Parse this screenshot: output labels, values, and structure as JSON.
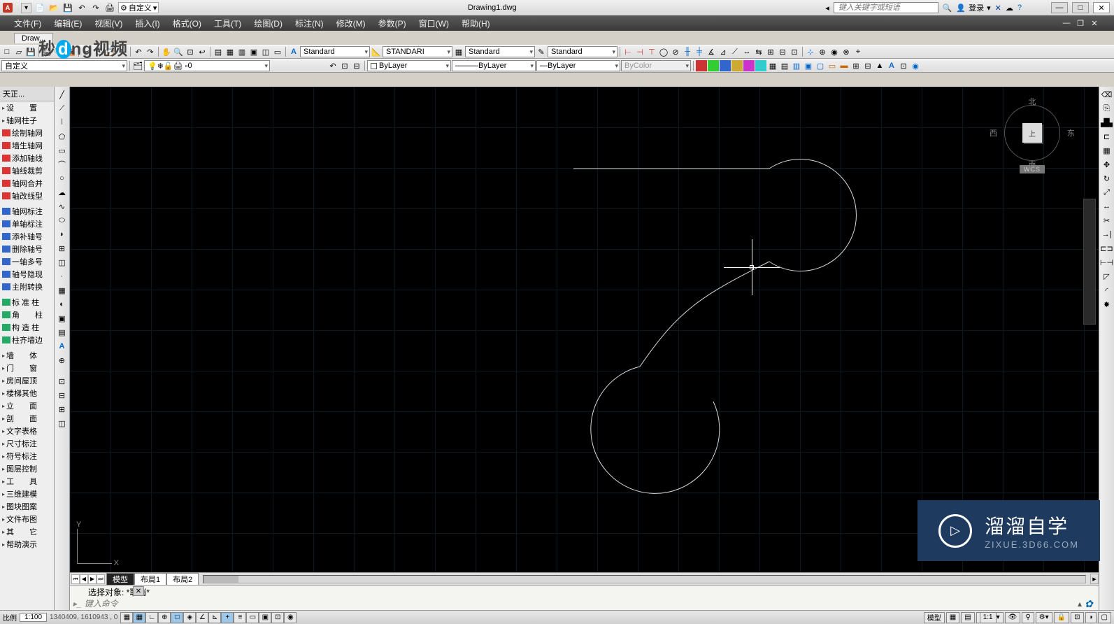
{
  "title": {
    "workspace": "自定义",
    "file": "Drawing1.dwg",
    "search_ph": "键入关键字或短语",
    "login": "登录"
  },
  "menu": [
    "文件(F)",
    "编辑(E)",
    "视图(V)",
    "插入(I)",
    "格式(O)",
    "工具(T)",
    "绘图(D)",
    "标注(N)",
    "修改(M)",
    "参数(P)",
    "窗口(W)",
    "帮助(H)"
  ],
  "drawtab": "Draw...",
  "props": {
    "ws": "自定义",
    "layer": "0",
    "color": "ByLayer",
    "ltype": "ByLayer",
    "lweight": "ByLayer",
    "plotstyle": "ByColor",
    "std1": "Standard",
    "std2": "STANDARI",
    "std3": "Standard",
    "std4": "Standard"
  },
  "tpanel": {
    "title": "天正...",
    "g1": [
      "设　　置",
      "轴网柱子"
    ],
    "g2": [
      "绘制轴网",
      "墙生轴网",
      "添加轴线",
      "轴线裁剪",
      "轴网合并",
      "轴改线型"
    ],
    "g3": [
      "轴网标注",
      "单轴标注",
      "添补轴号",
      "删除轴号",
      "一轴多号",
      "轴号隐现",
      "主附转换"
    ],
    "g4": [
      "标 准 柱",
      "角　　柱",
      "构 造 柱",
      "柱齐墙边"
    ],
    "g5": [
      "墙　　体",
      "门　　窗",
      "房间屋顶",
      "楼梯其他",
      "立　　面",
      "剖　　面",
      "文字表格",
      "尺寸标注",
      "符号标注",
      "图层控制",
      "工　　具",
      "三维建模",
      "图块图案",
      "文件布图",
      "其　　它",
      "帮助演示"
    ]
  },
  "viewcube": {
    "n": "北",
    "s": "南",
    "e": "东",
    "w": "西",
    "top": "上",
    "wcs": "WCS"
  },
  "tabs": {
    "model": "模型",
    "l1": "布局1",
    "l2": "布局2"
  },
  "cmd": {
    "hist": "选择对象: *取消*",
    "prompt": "键入命令"
  },
  "status": {
    "scale_label": "比例",
    "scale": "1:100",
    "coords": "1340409, 1610943 , 0",
    "right_ws": "模型",
    "anno": "1:1",
    "dyn": "▼"
  },
  "watermark": {
    "name": "溜溜自学",
    "url": "ZIXUE.3D66.COM"
  }
}
